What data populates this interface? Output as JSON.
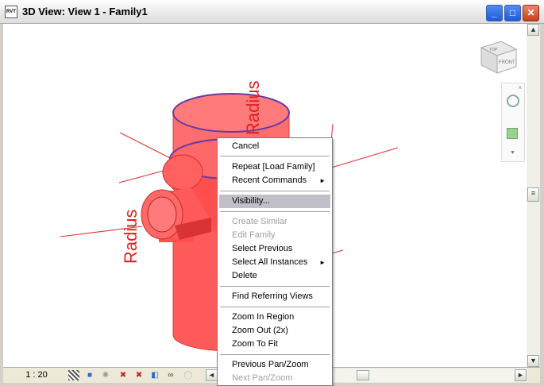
{
  "window": {
    "title": "3D View: View 1 - Family1",
    "app_icon_text": "RVT",
    "minimize": "_",
    "maximize": "□",
    "close": "✕"
  },
  "viewcube": {
    "top_label": "TOP",
    "front_label": "FRONT"
  },
  "model": {
    "label_radius_top": "Radius",
    "label_radius_left": "Radius",
    "model_color": "#ff5a5a",
    "outline_color": "#6a3aa0"
  },
  "context_menu": {
    "items": [
      {
        "label": "Cancel",
        "enabled": true
      },
      {
        "label": "Repeat [Load Family]",
        "enabled": true
      },
      {
        "label": "Recent Commands",
        "enabled": true,
        "submenu": "►"
      },
      {
        "label": "Visibility...",
        "enabled": true,
        "highlighted": true
      },
      {
        "label": "Create Similar",
        "enabled": false
      },
      {
        "label": "Edit Family",
        "enabled": false
      },
      {
        "label": "Select Previous",
        "enabled": true
      },
      {
        "label": "Select All Instances",
        "enabled": true,
        "submenu": "►"
      },
      {
        "label": "Delete",
        "enabled": true
      },
      {
        "label": "Find Referring Views",
        "enabled": true
      },
      {
        "label": "Zoom In Region",
        "enabled": true
      },
      {
        "label": "Zoom Out (2x)",
        "enabled": true
      },
      {
        "label": "Zoom To Fit",
        "enabled": true
      },
      {
        "label": "Previous Pan/Zoom",
        "enabled": true
      },
      {
        "label": "Next Pan/Zoom",
        "enabled": false
      }
    ]
  },
  "statusbar": {
    "scale": "1 : 20",
    "icons": [
      "detail-level-icon",
      "visual-style-icon",
      "sun-path-icon",
      "shadows-icon",
      "crop-view-icon",
      "show-crop-icon",
      "temporary-hide-icon",
      "reveal-hidden-icon"
    ]
  },
  "colors": {
    "highlight": "#c1c0c9",
    "disabled_text": "#a0a0a0"
  }
}
